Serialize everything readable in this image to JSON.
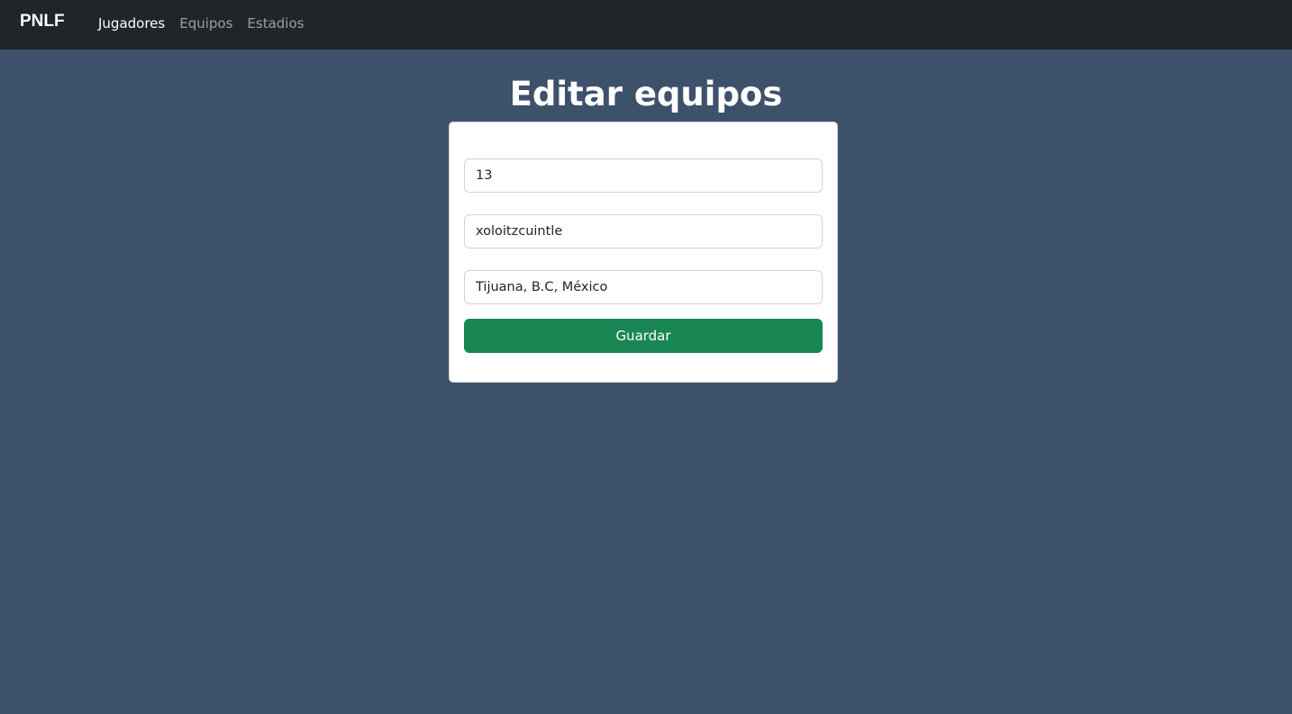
{
  "navbar": {
    "brand": "PNLF",
    "links": [
      {
        "label": "Jugadores",
        "active": true
      },
      {
        "label": "Equipos",
        "active": false
      },
      {
        "label": "Estadios",
        "active": false
      }
    ]
  },
  "page": {
    "title": "Editar equipos"
  },
  "form": {
    "fields": [
      {
        "value": "13"
      },
      {
        "value": "xoloitzcuintle"
      },
      {
        "value": "Tijuana, B.C, México"
      }
    ],
    "submit_label": "Guardar"
  },
  "colors": {
    "background": "#3d516b",
    "navbar": "#212529",
    "submit": "#198754"
  }
}
